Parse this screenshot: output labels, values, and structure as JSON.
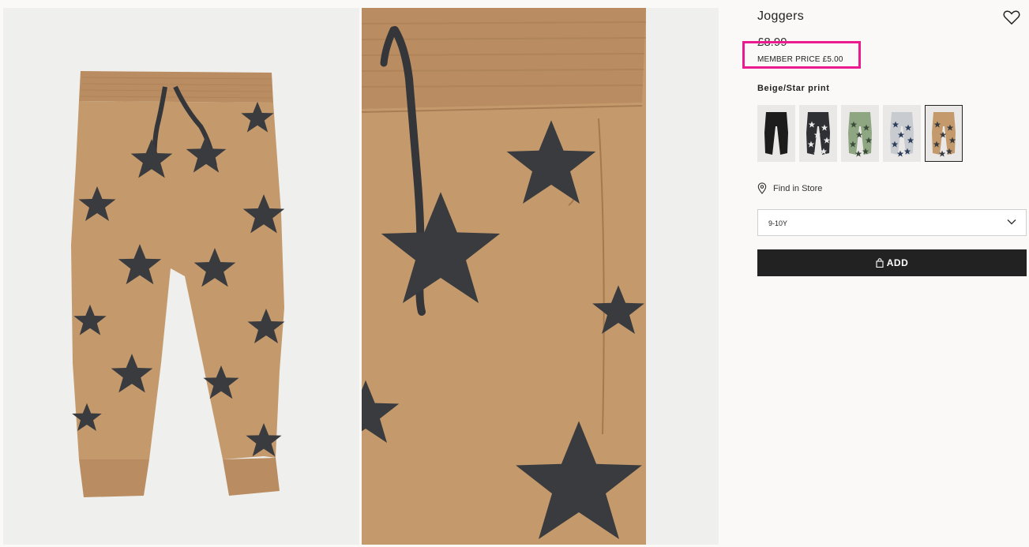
{
  "product": {
    "title": "Joggers",
    "price": "£8.99",
    "member_price": "MEMBER PRICE £5.00",
    "color_name": "Beige/Star print"
  },
  "swatches": [
    {
      "name": "Black",
      "fabric": "#1c1c1c",
      "print": "none"
    },
    {
      "name": "Dark grey/Star print",
      "fabric": "#2f3034",
      "print": "#e8e8e8"
    },
    {
      "name": "Green/Star print",
      "fabric": "#8ea782",
      "print": "#3b4a3a"
    },
    {
      "name": "Light grey/Star print",
      "fabric": "#c8ccd1",
      "print": "#2e3f5c"
    },
    {
      "name": "Beige/Star print",
      "fabric": "#c49a6c",
      "print": "#3a3b3f",
      "selected": true
    }
  ],
  "find_in_store": "Find in Store",
  "size": {
    "selected": "9-10Y"
  },
  "add_label": "ADD",
  "colors": {
    "beige": "#c49a6c",
    "star": "#3a3b3f",
    "highlight": "#ec1a8f",
    "button": "#222222"
  },
  "icons": {
    "favorite": "heart-icon",
    "store": "location-pin-icon",
    "dropdown": "chevron-down-icon",
    "bag": "shopping-bag-icon"
  }
}
